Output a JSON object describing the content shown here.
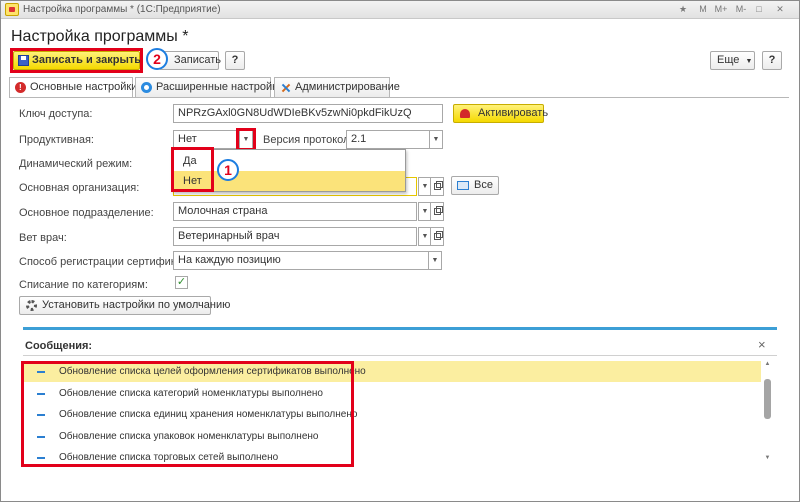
{
  "window": {
    "title": "Настройка программы * (1С:Предприятие)",
    "controls": [
      "★",
      "M",
      "M+",
      "M-",
      "□",
      "✕"
    ]
  },
  "page_title": "Настройка программы *",
  "toolbar": {
    "save_close_label": "Записать и закрыть",
    "save_label": "Записать",
    "help_label": "?",
    "more_label": "Еще",
    "help2_label": "?"
  },
  "badges": {
    "b1": "1",
    "b2": "2"
  },
  "tabs": [
    {
      "label": "Основные настройки",
      "icon": "warning-icon"
    },
    {
      "label": "Расширенные настройки",
      "icon": "settings-icon"
    },
    {
      "label": "Администрирование",
      "icon": "tools-icon"
    }
  ],
  "form": {
    "access_key_label": "Ключ доступа:",
    "access_key_value": "NPRzGAxl0GN8UdWDIeBKv5zwNi0pkdFikUzQ",
    "activate_label": "Активировать",
    "productive_label": "Продуктивная:",
    "productive_value": "Нет",
    "protocol_label": "Версия протокола:",
    "protocol_value": "2.1",
    "dynamic_label": "Динамический режим:",
    "org_label": "Основная организация:",
    "all_label": "Все",
    "division_label": "Основное подразделение:",
    "division_value": "Молочная страна",
    "vet_label": "Вет врач:",
    "vet_value": "Ветеринарный врач",
    "cert_reg_label": "Способ регистрации сертификатов:",
    "cert_reg_value": "На каждую позицию",
    "writeoff_label": "Списание по категориям:",
    "writeoff_checked": true,
    "defaults_label": "Установить настройки по умолчанию"
  },
  "dropdown": {
    "options": [
      "Да",
      "Нет"
    ],
    "selected": "Нет"
  },
  "messages": {
    "title": "Сообщения:",
    "items": [
      "Обновление списка целей оформления сертификатов выполнено",
      "Обновление списка категорий номенклатуры выполнено",
      "Обновление списка единиц хранения номенклатуры выполнено",
      "Обновление списка упаковок номенклатуры выполнено",
      "Обновление списка торговых сетей выполнено"
    ]
  },
  "colors": {
    "accent": "#3c9fd6",
    "highlight": "#fbe37a",
    "annotation": "#e2001a"
  }
}
